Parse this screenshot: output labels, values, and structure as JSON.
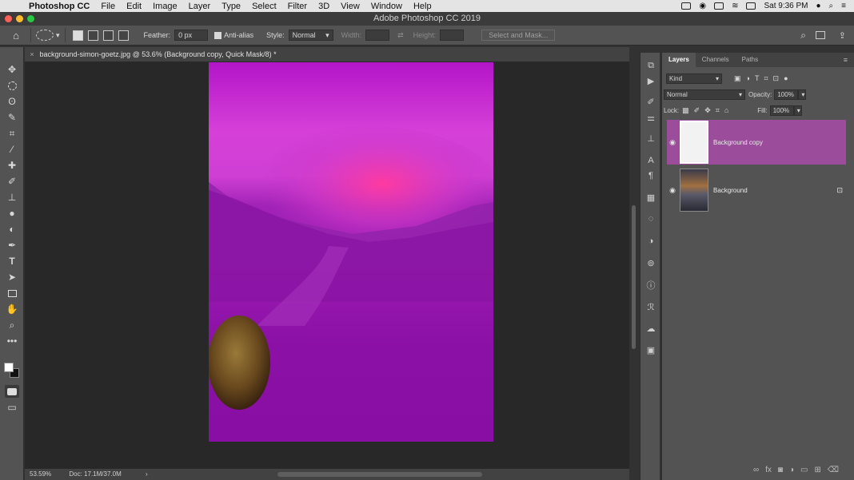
{
  "menubar": {
    "app_name": "Photoshop CC",
    "items": [
      "File",
      "Edit",
      "Image",
      "Layer",
      "Type",
      "Select",
      "Filter",
      "3D",
      "View",
      "Window",
      "Help"
    ],
    "clock": "Sat 9:36 PM"
  },
  "window": {
    "title": "Adobe Photoshop CC 2019"
  },
  "options": {
    "feather_label": "Feather:",
    "feather_value": "0 px",
    "anti_alias_label": "Anti-alias",
    "style_label": "Style:",
    "style_value": "Normal",
    "width_label": "Width:",
    "height_label": "Height:",
    "select_mask_label": "Select and Mask..."
  },
  "document": {
    "tab_title": "background-simon-goetz.jpg @ 53.6% (Background copy, Quick Mask/8) *"
  },
  "status": {
    "zoom": "53.59%",
    "doc_size": "Doc: 17.1M/37.0M"
  },
  "panel": {
    "tabs": [
      "Layers",
      "Channels",
      "Paths"
    ],
    "filter_kind": "Kind",
    "blend_mode": "Normal",
    "opacity_label": "Opacity:",
    "opacity_value": "100%",
    "lock_label": "Lock:",
    "fill_label": "Fill:",
    "fill_value": "100%",
    "layers": [
      {
        "name": "Background copy",
        "selected": true
      },
      {
        "name": "Background",
        "selected": false,
        "locked": true
      }
    ]
  },
  "colors": {
    "quick_mask_overlay": "#a020b8",
    "selected_layer": "#9b4c9b",
    "panel_bg": "#535353"
  }
}
